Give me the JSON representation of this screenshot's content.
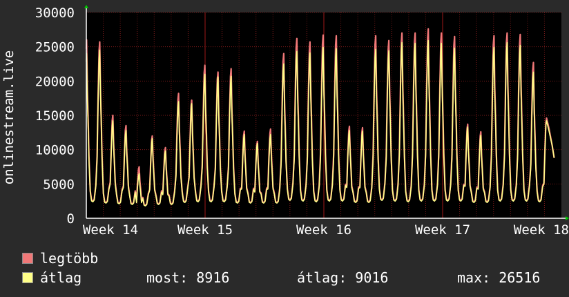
{
  "chart_data": {
    "type": "area",
    "ylabel": "onlinestream.live",
    "ylim": [
      0,
      30000
    ],
    "yticks": [
      0,
      5000,
      10000,
      15000,
      20000,
      25000,
      30000
    ],
    "xticks": [
      "Week 14",
      "Week 15",
      "Week 16",
      "Week 17",
      "Week 18"
    ],
    "grid": true,
    "colors": {
      "background": "#000000",
      "grid": "#7a1a1a",
      "max": "#f07878",
      "avg": "#ffff88",
      "axis": "#ffffff",
      "arrow": "#00cc00"
    },
    "series": [
      {
        "name": "legtöbb",
        "color": "#f07878",
        "peaks": [
          26000,
          25700,
          15000,
          13500,
          7500,
          12000,
          10300,
          18200,
          17200,
          22300,
          21300,
          21800,
          12700,
          11200,
          13000,
          24000,
          26200,
          25700,
          26700,
          26600,
          13400,
          13200,
          26600,
          25900,
          27000,
          27000,
          27600,
          27000,
          26500,
          13700,
          12600,
          26600,
          27000,
          26800,
          22700,
          14600
        ],
        "troughs": [
          2500,
          2300,
          2200,
          2100,
          1900,
          2100,
          2100,
          2400,
          2500,
          2500,
          2500,
          2300,
          2300,
          2300,
          2300,
          2700,
          2600,
          2500,
          2600,
          2600,
          2400,
          2400,
          2700,
          2600,
          2500,
          2600,
          2600,
          2600,
          2600,
          2400,
          2400,
          2600,
          2600,
          2600,
          2500,
          8800
        ]
      },
      {
        "name": "átlag",
        "color": "#ffff88",
        "peaks": [
          24000,
          24500,
          14200,
          12800,
          6500,
          11600,
          9800,
          17000,
          16700,
          21000,
          20600,
          20700,
          12200,
          10900,
          12200,
          22500,
          24300,
          24100,
          24900,
          24700,
          12800,
          12700,
          24600,
          24400,
          25600,
          25500,
          25900,
          25500,
          24800,
          13300,
          12100,
          24900,
          25600,
          25200,
          21300,
          14200
        ],
        "troughs": [
          2400,
          2200,
          2100,
          2000,
          1800,
          2000,
          2000,
          2300,
          2400,
          2400,
          2400,
          2200,
          2200,
          2200,
          2200,
          2600,
          2500,
          2400,
          2500,
          2500,
          2300,
          2300,
          2600,
          2500,
          2400,
          2500,
          2500,
          2500,
          2500,
          2300,
          2300,
          2500,
          2500,
          2500,
          2400,
          8800
        ]
      }
    ]
  },
  "legend": [
    {
      "label": "legtöbb",
      "color": "#f07878"
    },
    {
      "label": "átlag",
      "color": "#ffff88"
    }
  ],
  "stats": {
    "most": "most: 8916",
    "atlag": "átlag: 9016",
    "max": "max: 26516"
  }
}
